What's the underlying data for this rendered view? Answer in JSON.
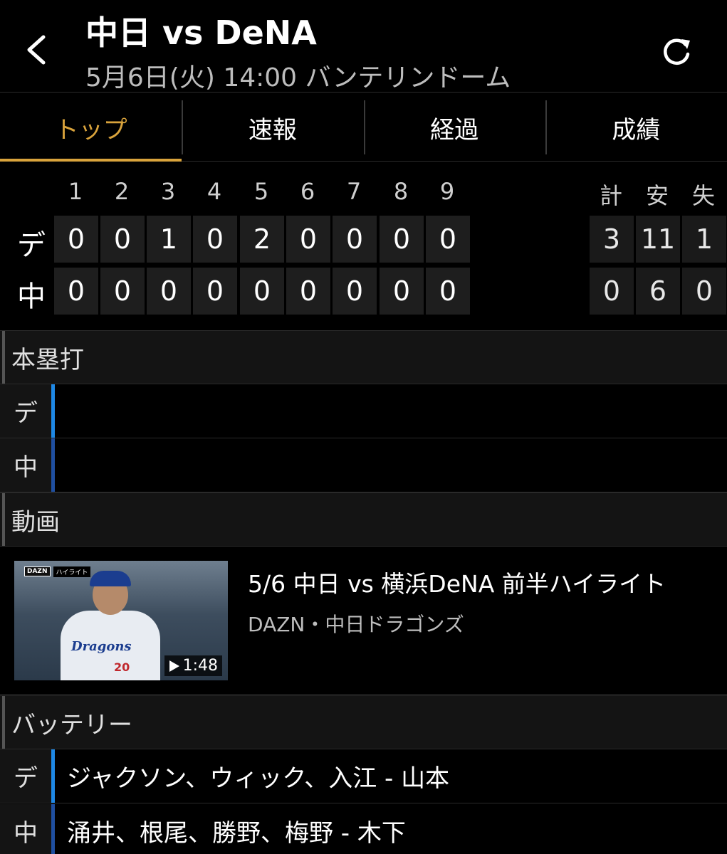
{
  "header": {
    "title": "中日 vs DeNA",
    "subtitle": "5月6日(火) 14:00 バンテリンドーム"
  },
  "tabs": [
    {
      "label": "トップ",
      "active": true
    },
    {
      "label": "速報",
      "active": false
    },
    {
      "label": "経過",
      "active": false
    },
    {
      "label": "成績",
      "active": false
    }
  ],
  "scoreboard": {
    "innings": [
      "1",
      "2",
      "3",
      "4",
      "5",
      "6",
      "7",
      "8",
      "9"
    ],
    "total_headers": [
      "計",
      "安",
      "失"
    ],
    "teams": [
      {
        "abbr": "デ",
        "scores": [
          "0",
          "0",
          "1",
          "0",
          "2",
          "0",
          "0",
          "0",
          "0"
        ],
        "totals": [
          "3",
          "11",
          "1"
        ]
      },
      {
        "abbr": "中",
        "scores": [
          "0",
          "0",
          "0",
          "0",
          "0",
          "0",
          "0",
          "0",
          "0"
        ],
        "totals": [
          "0",
          "6",
          "0"
        ]
      }
    ]
  },
  "home_runs": {
    "heading": "本塁打",
    "rows": [
      {
        "team": "デ",
        "text": ""
      },
      {
        "team": "中",
        "text": ""
      }
    ]
  },
  "video": {
    "heading": "動画",
    "title": "5/6 中日 vs 横浜DeNA 前半ハイライト",
    "source": "DAZN・中日ドラゴンズ",
    "duration": "1:48",
    "badge_service": "DAZN",
    "badge_label": "ハイライト"
  },
  "battery": {
    "heading": "バッテリー",
    "rows": [
      {
        "team": "デ",
        "text": "ジャクソン、ウィック、入江 - 山本"
      },
      {
        "team": "中",
        "text": "涌井、根尾、勝野、梅野 - 木下"
      }
    ]
  },
  "colors": {
    "accent": "#d9a33c",
    "dena_bar": "#1e88e5",
    "chunichi_bar": "#1f4fa0"
  }
}
